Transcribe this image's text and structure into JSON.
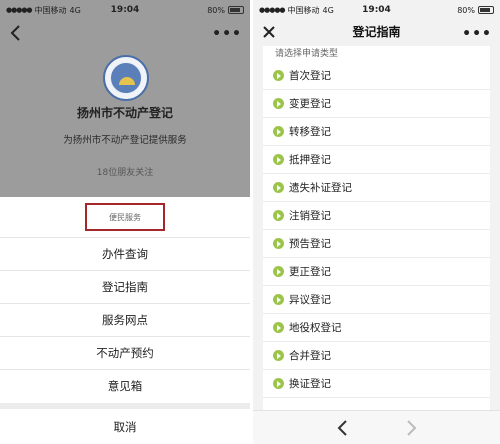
{
  "left": {
    "status": {
      "carrier": "中国移动",
      "network": "4G",
      "time": "19:04",
      "battery": "80%"
    },
    "more_label": "•••",
    "account": {
      "name": "扬州市不动产登记",
      "description": "为扬州市不动产登记提供服务",
      "followers": "18位朋友关注"
    },
    "sheet": {
      "header": "便民服务",
      "items": [
        "办件查询",
        "登记指南",
        "服务网点",
        "不动产预约",
        "意见箱"
      ],
      "cancel": "取消"
    }
  },
  "right": {
    "status": {
      "carrier": "中国移动",
      "network": "4G",
      "time": "19:04",
      "battery": "80%"
    },
    "title": "登记指南",
    "more_label": "•••",
    "prompt": "请选择申请类型",
    "items": [
      "首次登记",
      "变更登记",
      "转移登记",
      "抵押登记",
      "遗失补证登记",
      "注销登记",
      "预告登记",
      "更正登记",
      "异议登记",
      "地役权登记",
      "合并登记",
      "换证登记"
    ]
  },
  "colors": {
    "accent_red": "#a3272b",
    "item_icon_green": "#9bc54a",
    "overlay_gray": "#9c9c9c"
  }
}
